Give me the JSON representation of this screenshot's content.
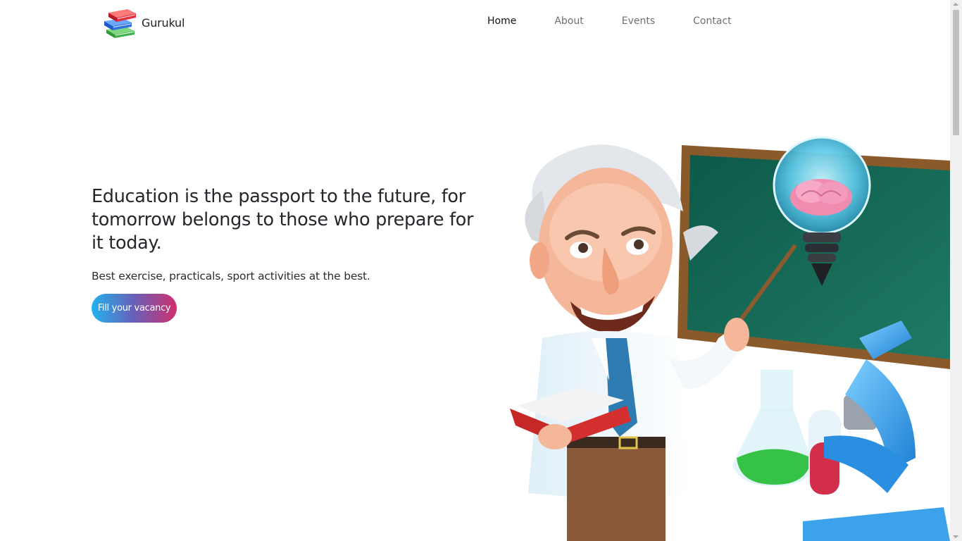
{
  "brand": {
    "name": "Gurukul",
    "logo_icon": "stacked-books-icon"
  },
  "nav": {
    "items": [
      {
        "label": "Home",
        "active": true
      },
      {
        "label": "About",
        "active": false
      },
      {
        "label": "Events",
        "active": false
      },
      {
        "label": "Contact",
        "active": false
      }
    ]
  },
  "hero": {
    "heading": "Education is the passport to the future, for tomorrow belongs to those who prepare for it today.",
    "subtext": "Best exercise, practicals, sport activities at the best.",
    "cta_label": "Fill your vacancy",
    "illustration": "scientist-teacher-illustration"
  },
  "colors": {
    "cta_gradient_start": "#21b2ee",
    "cta_gradient_mid": "#6a5fb8",
    "cta_gradient_end": "#cf2f6d",
    "nav_active": "#111111",
    "nav_inactive": "#6c6f73"
  }
}
